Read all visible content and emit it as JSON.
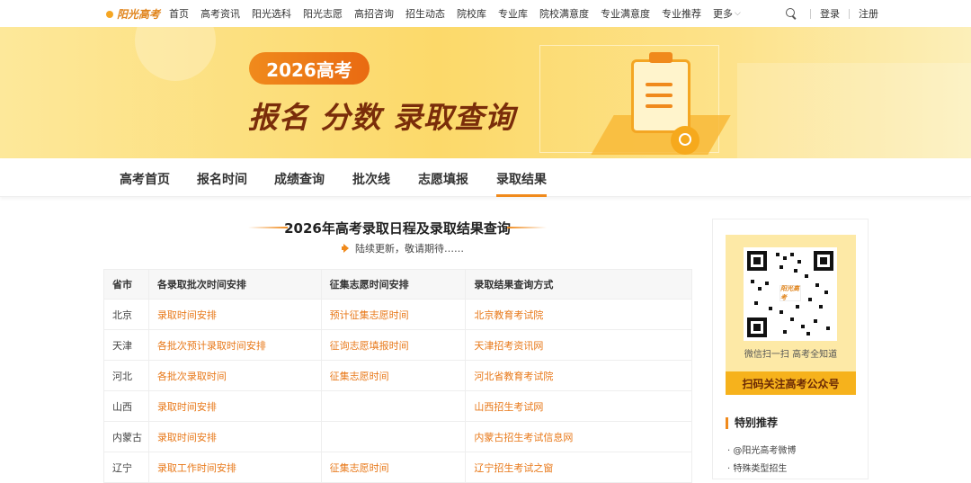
{
  "logo": {
    "text": "阳光高考"
  },
  "nav": {
    "items": [
      "首页",
      "高考资讯",
      "阳光选科",
      "阳光志愿",
      "高招咨询",
      "招生动态",
      "院校库",
      "专业库",
      "院校满意度",
      "专业满意度",
      "专业推荐"
    ],
    "more": "更多",
    "login": "登录",
    "register": "注册"
  },
  "banner": {
    "pill": "2026高考",
    "headline": "报名 分数 录取查询"
  },
  "subnav": {
    "tabs": [
      "高考首页",
      "报名时间",
      "成绩查询",
      "批次线",
      "志愿填报",
      "录取结果"
    ],
    "active_index": 5
  },
  "main": {
    "title": "2026年高考录取日程及录取结果查询",
    "notice": "陆续更新，敬请期待……",
    "table": {
      "headers": [
        "省市",
        "各录取批次时间安排",
        "征集志愿时间安排",
        "录取结果查询方式"
      ],
      "rows": [
        [
          "北京",
          "录取时间安排",
          "预计征集志愿时间",
          "北京教育考试院"
        ],
        [
          "天津",
          "各批次预计录取时间安排",
          "征询志愿填报时间",
          "天津招考资讯网"
        ],
        [
          "河北",
          "各批次录取时间",
          "征集志愿时间",
          "河北省教育考试院"
        ],
        [
          "山西",
          "录取时间安排",
          "",
          "山西招生考试网"
        ],
        [
          "内蒙古",
          "录取时间安排",
          "",
          "内蒙古招生考试信息网"
        ],
        [
          "辽宁",
          "录取工作时间安排",
          "征集志愿时间",
          "辽宁招生考试之窗"
        ]
      ]
    }
  },
  "side": {
    "qr_logo": "阳光高考",
    "qr_caption": "微信扫一扫  高考全知道",
    "qr_button": "扫码关注高考公众号",
    "special_title": "特别推荐",
    "links": [
      "@阳光高考微博",
      "特殊类型招生"
    ]
  },
  "colors": {
    "accent": "#f08a1c",
    "link": "#e8791a",
    "banner_bg": "#fcd96a",
    "headline": "#7a2d0a"
  }
}
